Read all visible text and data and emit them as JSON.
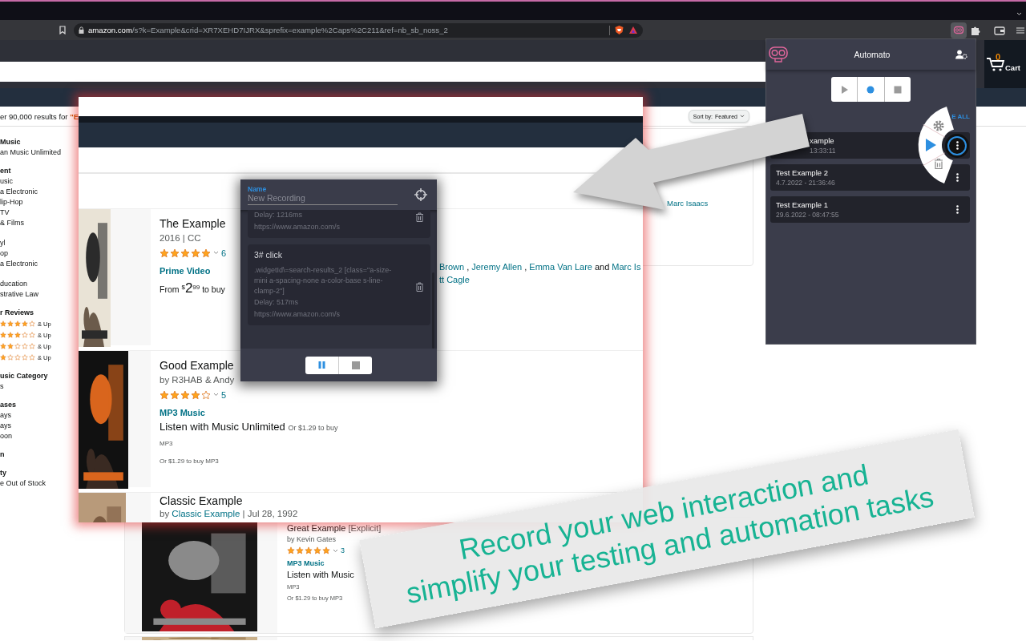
{
  "browser": {
    "url_host": "amazon.com",
    "url_path": "/s?k=Example&crid=XR7XEHD7IJRX&sprefix=example%2Caps%2C211&ref=nb_sb_noss_2",
    "extension_active": true
  },
  "store": {
    "cart_count": "0",
    "cart_label": "Cart",
    "results_prefix": "er 90,000 results for ",
    "results_query": "\"E",
    "sort_label": "Sort by:",
    "sort_value": "Featured"
  },
  "filters": [
    {
      "heading": "Music",
      "items": [
        "an Music Unlimited"
      ]
    },
    {
      "heading": "ent",
      "items": [
        "usic",
        "a Electronic",
        "lip-Hop",
        "TV",
        "& Films"
      ]
    },
    {
      "items": [
        "yl",
        "op",
        "a Electronic"
      ]
    },
    {
      "items": [
        "ducation",
        "strative Law"
      ]
    },
    {
      "heading": "r Reviews",
      "ratings": [
        {
          "stars": 4,
          "label": "& Up"
        },
        {
          "stars": 3,
          "label": "& Up"
        },
        {
          "stars": 2,
          "label": "& Up"
        },
        {
          "stars": 1,
          "label": "& Up"
        }
      ]
    },
    {
      "heading": "usic Category",
      "items": [
        "s"
      ]
    },
    {
      "heading": "ases",
      "items": [
        "ays",
        "ays",
        "oon"
      ]
    },
    {
      "heading": "n"
    },
    {
      "heading": "ty",
      "items": [
        "e Out of Stock"
      ]
    }
  ],
  "results": [
    {
      "kind": "credit",
      "text": "Marc Isaacs"
    },
    {
      "kind": "product",
      "title": "Great Example",
      "title_note": "[Explicit]",
      "byline": "by Kevin Gates",
      "stars": 5,
      "reviews": "3",
      "format": "MP3 Music",
      "offer": "Listen with Music",
      "format_small": "MP3",
      "price_line": "Or $1.29 to buy MP3"
    },
    {
      "kind": "picture"
    }
  ],
  "sheet": {
    "products": [
      {
        "title": "The Example",
        "byline": "2016  |  CC",
        "stars": 5,
        "reviews": "6",
        "format": "Prime Video",
        "price": {
          "lead": "From",
          "currency": "$",
          "whole": "2",
          "fraction": "99",
          "tail": "to buy"
        },
        "credits": [
          {
            "text": "Brown",
            "link": true
          },
          {
            "text": ",",
            "link": false
          },
          {
            "text": "Jeremy Allen",
            "link": true
          },
          {
            "text": ",",
            "link": false
          },
          {
            "text": "Emma Van Lare",
            "link": true
          },
          {
            "text": "and",
            "link": false
          },
          {
            "text": "Marc Is",
            "link": true
          }
        ],
        "credits_more": "tt Cagle"
      },
      {
        "title": "Good Example",
        "byline": "by R3HAB & Andy",
        "stars": 4,
        "reviews": "5",
        "format": "MP3 Music",
        "offer": "Listen with Music Unlimited",
        "offer_note": "Or $1.29 to buy",
        "format_small": "MP3",
        "price_line": "Or $1.29 to buy MP3"
      },
      {
        "title": "Classic Example",
        "byline": "by",
        "byline_link": "Classic Example",
        "byline_date": "|  Jul 28, 1992"
      }
    ]
  },
  "recorder": {
    "name_label": "Name",
    "name_placeholder": "New Recording",
    "recording": true,
    "steps": [
      {
        "delay": "Delay: 1216ms",
        "url": "https://www.amazon.com/s"
      },
      {
        "title": "3# click",
        "selector": ".widgetId\\=search-results_2 [class=\"a-size-mini a-spacing-none a-color-base s-line-clamp-2\"]",
        "delay": "Delay: 517ms",
        "url": "https://www.amazon.com/s"
      }
    ]
  },
  "automato": {
    "title": "Automato",
    "controls": [
      {
        "kind": "play",
        "active": false
      },
      {
        "kind": "record",
        "active": true
      },
      {
        "kind": "stop",
        "active": false
      }
    ],
    "delete_all": "E ALL",
    "recordings": [
      {
        "name": "xample",
        "date": "13:33:11",
        "menu_open": true
      },
      {
        "name": "Test Example 2",
        "date": "4.7.2022 - 21:36:46",
        "menu_open": false
      },
      {
        "name": "Test Example 1",
        "date": "29.6.2022 - 08:47:55",
        "menu_open": false
      }
    ]
  },
  "caption": {
    "line_1": "Record your web interaction and",
    "line_2": "simplify your testing and automation tasks"
  }
}
